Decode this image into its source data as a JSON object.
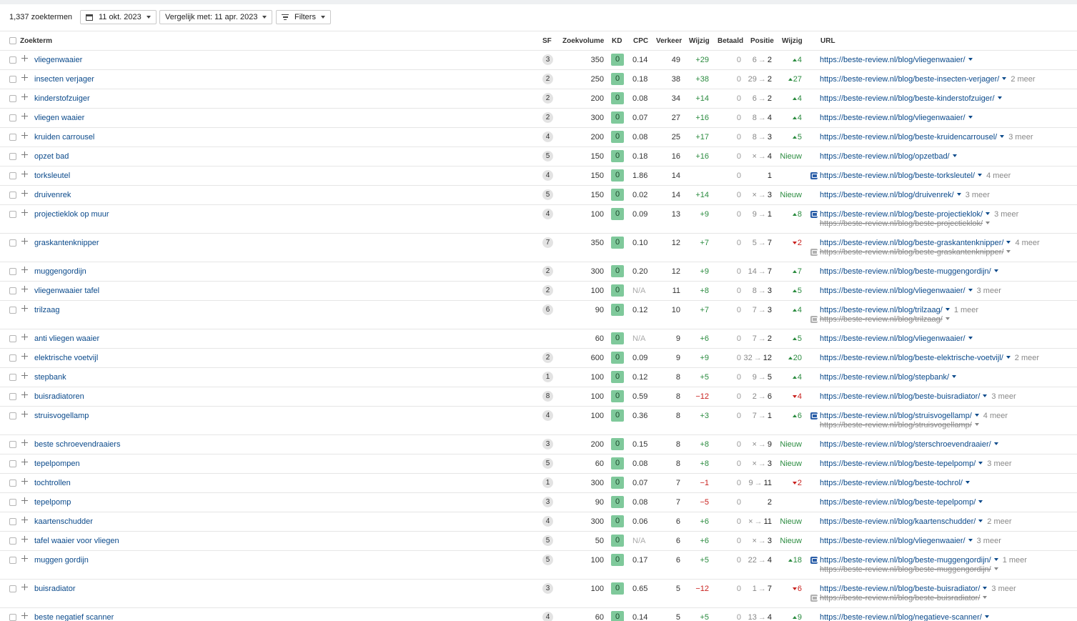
{
  "toolbar": {
    "count_label": "1,337 zoektermen",
    "date_label": "11 okt. 2023",
    "compare_label": "Vergelijk met: 11 apr. 2023",
    "filters_label": "Filters"
  },
  "columns": {
    "keyword": "Zoekterm",
    "sf": "SF",
    "volume": "Zoekvolume",
    "kd": "KD",
    "cpc": "CPC",
    "traffic": "Verkeer",
    "traffic_change": "Wijzig",
    "paid": "Betaald",
    "position": "Positie",
    "position_change": "Wijzig",
    "url": "URL"
  },
  "rows": [
    {
      "kw": "vliegenwaaier",
      "sf": "3",
      "vol": "350",
      "kd": "0",
      "cpc": "0.14",
      "traf": "49",
      "chg": "+29",
      "paid": "0",
      "from": "6",
      "to": "2",
      "pchg": "4",
      "pdir": "up",
      "url": "https://beste-review.nl/blog/vliegenwaaier/",
      "more": "",
      "url2": "",
      "icon": ""
    },
    {
      "kw": "insecten verjager",
      "sf": "2",
      "vol": "250",
      "kd": "0",
      "cpc": "0.18",
      "traf": "38",
      "chg": "+38",
      "paid": "0",
      "from": "29",
      "to": "2",
      "pchg": "27",
      "pdir": "up",
      "url": "https://beste-review.nl/blog/beste-insecten-verjager/",
      "more": "2 meer",
      "url2": "",
      "icon": ""
    },
    {
      "kw": "kinderstofzuiger",
      "sf": "2",
      "vol": "200",
      "kd": "0",
      "cpc": "0.08",
      "traf": "34",
      "chg": "+14",
      "paid": "0",
      "from": "6",
      "to": "2",
      "pchg": "4",
      "pdir": "up",
      "url": "https://beste-review.nl/blog/beste-kinderstofzuiger/",
      "more": "",
      "url2": "",
      "icon": ""
    },
    {
      "kw": "vliegen waaier",
      "sf": "2",
      "vol": "300",
      "kd": "0",
      "cpc": "0.07",
      "traf": "27",
      "chg": "+16",
      "paid": "0",
      "from": "8",
      "to": "4",
      "pchg": "4",
      "pdir": "up",
      "url": "https://beste-review.nl/blog/vliegenwaaier/",
      "more": "",
      "url2": "",
      "icon": ""
    },
    {
      "kw": "kruiden carrousel",
      "sf": "4",
      "vol": "200",
      "kd": "0",
      "cpc": "0.08",
      "traf": "25",
      "chg": "+17",
      "paid": "0",
      "from": "8",
      "to": "3",
      "pchg": "5",
      "pdir": "up",
      "url": "https://beste-review.nl/blog/beste-kruidencarrousel/",
      "more": "3 meer",
      "url2": "",
      "icon": ""
    },
    {
      "kw": "opzet bad",
      "sf": "5",
      "vol": "150",
      "kd": "0",
      "cpc": "0.18",
      "traf": "16",
      "chg": "+16",
      "paid": "0",
      "from": "×",
      "to": "4",
      "pchg": "Nieuw",
      "pdir": "new",
      "url": "https://beste-review.nl/blog/opzetbad/",
      "more": "",
      "url2": "",
      "icon": ""
    },
    {
      "kw": "torksleutel",
      "sf": "4",
      "vol": "150",
      "kd": "0",
      "cpc": "1.86",
      "traf": "14",
      "chg": "",
      "paid": "0",
      "from": "",
      "to": "1",
      "pchg": "",
      "pdir": "",
      "url": "https://beste-review.nl/blog/beste-torksleutel/",
      "more": "4 meer",
      "url2": "",
      "icon": "blue"
    },
    {
      "kw": "druivenrek",
      "sf": "5",
      "vol": "150",
      "kd": "0",
      "cpc": "0.02",
      "traf": "14",
      "chg": "+14",
      "paid": "0",
      "from": "×",
      "to": "3",
      "pchg": "Nieuw",
      "pdir": "new",
      "url": "https://beste-review.nl/blog/druivenrek/",
      "more": "3 meer",
      "url2": "",
      "icon": ""
    },
    {
      "kw": "projectieklok op muur",
      "sf": "4",
      "vol": "100",
      "kd": "0",
      "cpc": "0.09",
      "traf": "13",
      "chg": "+9",
      "paid": "0",
      "from": "9",
      "to": "1",
      "pchg": "8",
      "pdir": "up",
      "url": "https://beste-review.nl/blog/beste-projectieklok/",
      "more": "3 meer",
      "url2": "https://beste-review.nl/blog/beste-projectieklok/",
      "icon": "blue"
    },
    {
      "kw": "graskantenknipper",
      "sf": "7",
      "vol": "350",
      "kd": "0",
      "cpc": "0.10",
      "traf": "12",
      "chg": "+7",
      "paid": "0",
      "from": "5",
      "to": "7",
      "pchg": "2",
      "pdir": "down",
      "url": "https://beste-review.nl/blog/beste-graskantenknipper/",
      "more": "4 meer",
      "url2": "https://beste-review.nl/blog/beste-graskantenknipper/",
      "icon": "grey"
    },
    {
      "kw": "muggengordijn",
      "sf": "2",
      "vol": "300",
      "kd": "0",
      "cpc": "0.20",
      "traf": "12",
      "chg": "+9",
      "paid": "0",
      "from": "14",
      "to": "7",
      "pchg": "7",
      "pdir": "up",
      "url": "https://beste-review.nl/blog/beste-muggengordijn/",
      "more": "",
      "url2": "",
      "icon": ""
    },
    {
      "kw": "vliegenwaaier tafel",
      "sf": "2",
      "vol": "100",
      "kd": "0",
      "cpc": "N/A",
      "traf": "11",
      "chg": "+8",
      "paid": "0",
      "from": "8",
      "to": "3",
      "pchg": "5",
      "pdir": "up",
      "url": "https://beste-review.nl/blog/vliegenwaaier/",
      "more": "3 meer",
      "url2": "",
      "icon": ""
    },
    {
      "kw": "trilzaag",
      "sf": "6",
      "vol": "90",
      "kd": "0",
      "cpc": "0.12",
      "traf": "10",
      "chg": "+7",
      "paid": "0",
      "from": "7",
      "to": "3",
      "pchg": "4",
      "pdir": "up",
      "url": "https://beste-review.nl/blog/trilzaag/",
      "more": "1 meer",
      "url2": "https://beste-review.nl/blog/trilzaag/",
      "icon": "grey"
    },
    {
      "kw": "anti vliegen waaier",
      "sf": "",
      "vol": "60",
      "kd": "0",
      "cpc": "N/A",
      "traf": "9",
      "chg": "+6",
      "paid": "0",
      "from": "7",
      "to": "2",
      "pchg": "5",
      "pdir": "up",
      "url": "https://beste-review.nl/blog/vliegenwaaier/",
      "more": "",
      "url2": "",
      "icon": ""
    },
    {
      "kw": "elektrische voetvijl",
      "sf": "2",
      "vol": "600",
      "kd": "0",
      "cpc": "0.09",
      "traf": "9",
      "chg": "+9",
      "paid": "0",
      "from": "32",
      "to": "12",
      "pchg": "20",
      "pdir": "up",
      "url": "https://beste-review.nl/blog/beste-elektrische-voetvijl/",
      "more": "2 meer",
      "url2": "",
      "icon": ""
    },
    {
      "kw": "stepbank",
      "sf": "1",
      "vol": "100",
      "kd": "0",
      "cpc": "0.12",
      "traf": "8",
      "chg": "+5",
      "paid": "0",
      "from": "9",
      "to": "5",
      "pchg": "4",
      "pdir": "up",
      "url": "https://beste-review.nl/blog/stepbank/",
      "more": "",
      "url2": "",
      "icon": ""
    },
    {
      "kw": "buisradiatoren",
      "sf": "8",
      "vol": "100",
      "kd": "0",
      "cpc": "0.59",
      "traf": "8",
      "chg": "−12",
      "paid": "0",
      "from": "2",
      "to": "6",
      "pchg": "4",
      "pdir": "down",
      "url": "https://beste-review.nl/blog/beste-buisradiator/",
      "more": "3 meer",
      "url2": "",
      "icon": ""
    },
    {
      "kw": "struisvogellamp",
      "sf": "4",
      "vol": "100",
      "kd": "0",
      "cpc": "0.36",
      "traf": "8",
      "chg": "+3",
      "paid": "0",
      "from": "7",
      "to": "1",
      "pchg": "6",
      "pdir": "up",
      "url": "https://beste-review.nl/blog/struisvogellamp/",
      "more": "4 meer",
      "url2": "https://beste-review.nl/blog/struisvogellamp/",
      "icon": "blue"
    },
    {
      "kw": "beste schroevendraaiers",
      "sf": "3",
      "vol": "200",
      "kd": "0",
      "cpc": "0.15",
      "traf": "8",
      "chg": "+8",
      "paid": "0",
      "from": "×",
      "to": "9",
      "pchg": "Nieuw",
      "pdir": "new",
      "url": "https://beste-review.nl/blog/sterschroevendraaier/",
      "more": "",
      "url2": "",
      "icon": ""
    },
    {
      "kw": "tepelpompen",
      "sf": "5",
      "vol": "60",
      "kd": "0",
      "cpc": "0.08",
      "traf": "8",
      "chg": "+8",
      "paid": "0",
      "from": "×",
      "to": "3",
      "pchg": "Nieuw",
      "pdir": "new",
      "url": "https://beste-review.nl/blog/beste-tepelpomp/",
      "more": "3 meer",
      "url2": "",
      "icon": ""
    },
    {
      "kw": "tochtrollen",
      "sf": "1",
      "vol": "300",
      "kd": "0",
      "cpc": "0.07",
      "traf": "7",
      "chg": "−1",
      "paid": "0",
      "from": "9",
      "to": "11",
      "pchg": "2",
      "pdir": "down",
      "url": "https://beste-review.nl/blog/beste-tochrol/",
      "more": "",
      "url2": "",
      "icon": ""
    },
    {
      "kw": "tepelpomp",
      "sf": "3",
      "vol": "90",
      "kd": "0",
      "cpc": "0.08",
      "traf": "7",
      "chg": "−5",
      "paid": "0",
      "from": "",
      "to": "2",
      "pchg": "",
      "pdir": "",
      "url": "https://beste-review.nl/blog/beste-tepelpomp/",
      "more": "",
      "url2": "",
      "icon": ""
    },
    {
      "kw": "kaartenschudder",
      "sf": "4",
      "vol": "300",
      "kd": "0",
      "cpc": "0.06",
      "traf": "6",
      "chg": "+6",
      "paid": "0",
      "from": "×",
      "to": "11",
      "pchg": "Nieuw",
      "pdir": "new",
      "url": "https://beste-review.nl/blog/kaartenschudder/",
      "more": "2 meer",
      "url2": "",
      "icon": ""
    },
    {
      "kw": "tafel waaier voor vliegen",
      "sf": "5",
      "vol": "50",
      "kd": "0",
      "cpc": "N/A",
      "traf": "6",
      "chg": "+6",
      "paid": "0",
      "from": "×",
      "to": "3",
      "pchg": "Nieuw",
      "pdir": "new",
      "url": "https://beste-review.nl/blog/vliegenwaaier/",
      "more": "3 meer",
      "url2": "",
      "icon": ""
    },
    {
      "kw": "muggen gordijn",
      "sf": "5",
      "vol": "100",
      "kd": "0",
      "cpc": "0.17",
      "traf": "6",
      "chg": "+5",
      "paid": "0",
      "from": "22",
      "to": "4",
      "pchg": "18",
      "pdir": "up",
      "url": "https://beste-review.nl/blog/beste-muggengordijn/",
      "more": "1 meer",
      "url2": "https://beste-review.nl/blog/beste-muggengordijn/",
      "icon": "blue"
    },
    {
      "kw": "buisradiator",
      "sf": "3",
      "vol": "100",
      "kd": "0",
      "cpc": "0.65",
      "traf": "5",
      "chg": "−12",
      "paid": "0",
      "from": "1",
      "to": "7",
      "pchg": "6",
      "pdir": "down",
      "url": "https://beste-review.nl/blog/beste-buisradiator/",
      "more": "3 meer",
      "url2": "https://beste-review.nl/blog/beste-buisradiator/",
      "icon": "grey"
    },
    {
      "kw": "beste negatief scanner",
      "sf": "4",
      "vol": "60",
      "kd": "0",
      "cpc": "0.14",
      "traf": "5",
      "chg": "+5",
      "paid": "0",
      "from": "13",
      "to": "4",
      "pchg": "9",
      "pdir": "up",
      "url": "https://beste-review.nl/blog/negatieve-scanner/",
      "more": "",
      "url2": "",
      "icon": ""
    }
  ]
}
